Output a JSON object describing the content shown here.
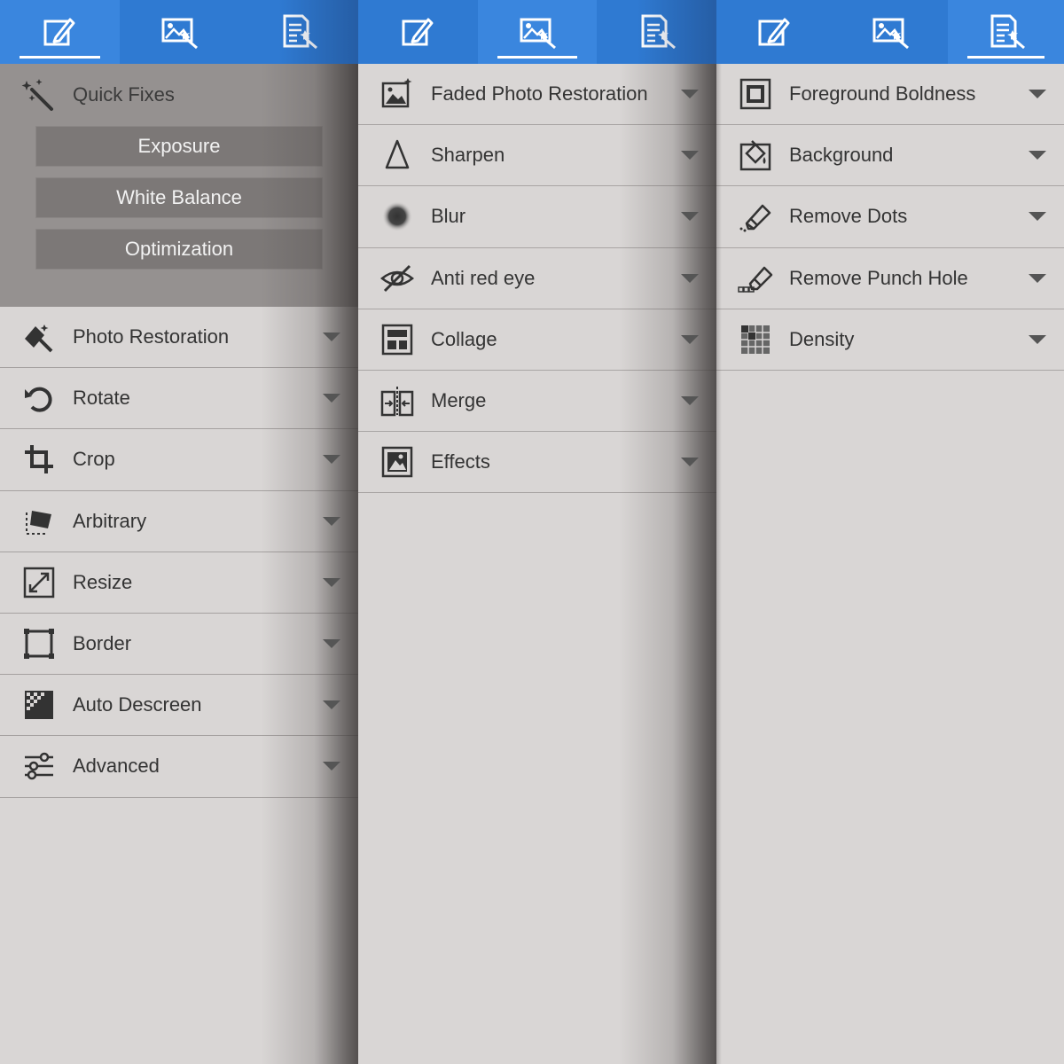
{
  "panels": [
    {
      "tabs": [
        {
          "icon": "edit-icon",
          "active": true
        },
        {
          "icon": "image-wand-icon",
          "active": false
        },
        {
          "icon": "document-wand-icon",
          "active": false
        }
      ],
      "quick_fixes": {
        "title": "Quick Fixes",
        "icon": "sparkle-wand-icon",
        "buttons": [
          "Exposure",
          "White Balance",
          "Optimization"
        ]
      },
      "items": [
        {
          "label": "Photo Restoration",
          "icon": "restoration-icon"
        },
        {
          "label": "Rotate",
          "icon": "rotate-icon"
        },
        {
          "label": "Crop",
          "icon": "crop-icon"
        },
        {
          "label": "Arbitrary",
          "icon": "arbitrary-icon"
        },
        {
          "label": "Resize",
          "icon": "resize-icon"
        },
        {
          "label": "Border",
          "icon": "border-icon"
        },
        {
          "label": "Auto Descreen",
          "icon": "descreen-icon"
        },
        {
          "label": "Advanced",
          "icon": "sliders-icon"
        }
      ]
    },
    {
      "tabs": [
        {
          "icon": "edit-icon",
          "active": false
        },
        {
          "icon": "image-wand-icon",
          "active": true
        },
        {
          "icon": "document-wand-icon",
          "active": false
        }
      ],
      "items": [
        {
          "label": "Faded Photo Restoration",
          "icon": "faded-photo-icon"
        },
        {
          "label": "Sharpen",
          "icon": "sharpen-icon"
        },
        {
          "label": "Blur",
          "icon": "blur-icon"
        },
        {
          "label": "Anti red eye",
          "icon": "red-eye-icon"
        },
        {
          "label": "Collage",
          "icon": "collage-icon"
        },
        {
          "label": "Merge",
          "icon": "merge-icon"
        },
        {
          "label": "Effects",
          "icon": "effects-icon"
        }
      ]
    },
    {
      "tabs": [
        {
          "icon": "edit-icon",
          "active": false
        },
        {
          "icon": "image-wand-icon",
          "active": false
        },
        {
          "icon": "document-wand-icon",
          "active": true
        }
      ],
      "items": [
        {
          "label": "Foreground Boldness",
          "icon": "foreground-icon"
        },
        {
          "label": "Background",
          "icon": "background-icon"
        },
        {
          "label": "Remove Dots",
          "icon": "eraser-icon"
        },
        {
          "label": "Remove Punch Hole",
          "icon": "punch-eraser-icon"
        },
        {
          "label": "Density",
          "icon": "density-icon"
        }
      ]
    }
  ],
  "colors": {
    "tabbar": "#2f7ad2",
    "tab_active": "#3a86de",
    "panel_bg": "#d9d6d5",
    "quick_bg": "#959190",
    "button_bg": "#7c7877"
  }
}
